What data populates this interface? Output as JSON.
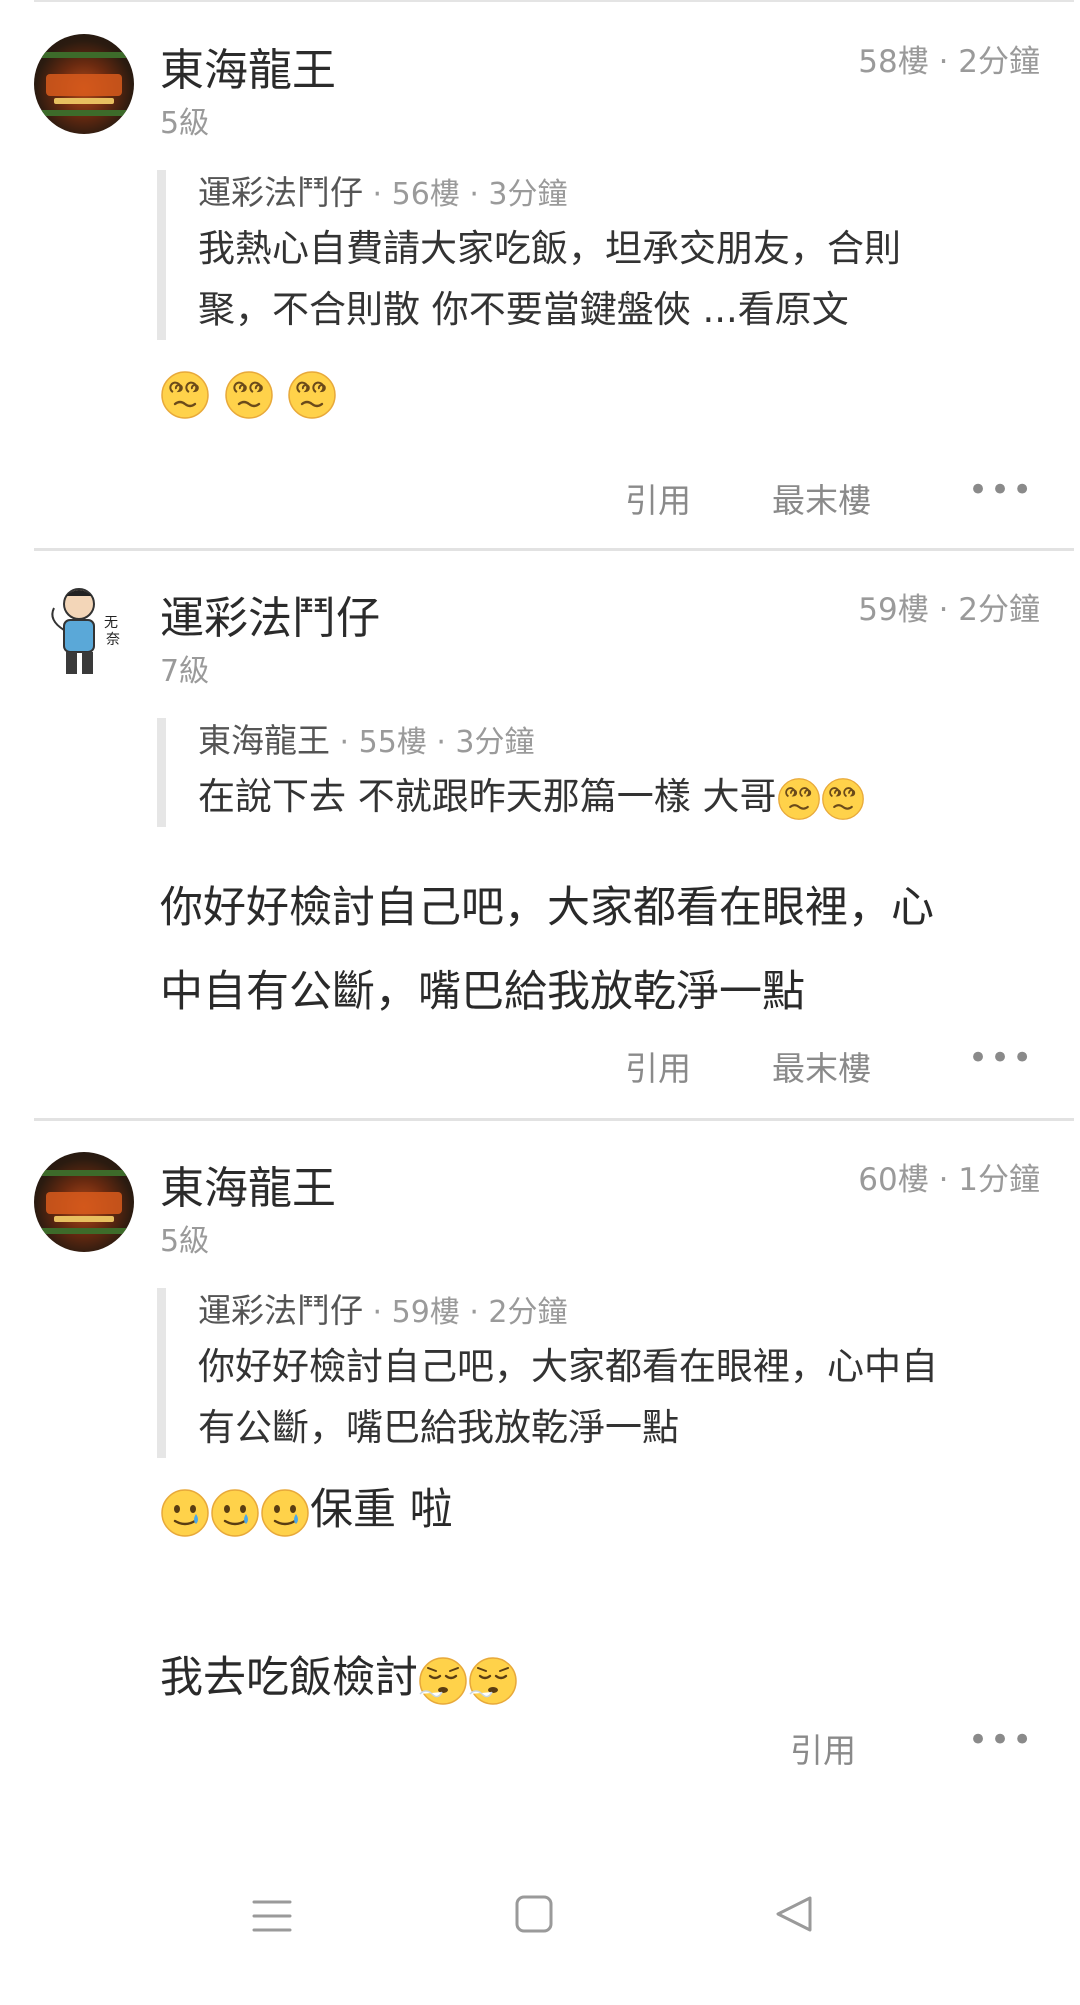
{
  "posts": [
    {
      "username": "東海龍王",
      "level": "5級",
      "meta": "58樓 · 2分鐘",
      "quote": {
        "author": "運彩法鬥仔",
        "meta": " · 56樓 · 3分鐘",
        "text_line1": "我熱心自費請大家吃飯，坦承交朋友，合則",
        "text_line2": "聚，不合則散 你不要當鍵盤俠 ...看原文"
      },
      "emoji_icon": "dizzy-face-emoji",
      "actions": {
        "quote": "引用",
        "last_floor": "最末樓"
      }
    },
    {
      "username": "運彩法鬥仔",
      "level": "7級",
      "meta": "59樓 · 2分鐘",
      "quote": {
        "author": "東海龍王",
        "meta": " · 55樓 · 3分鐘",
        "text": "在說下去 不就跟昨天那篇一樣 大哥"
      },
      "reply_line1": "你好好檢討自己吧，大家都看在眼裡，心",
      "reply_line2": "中自有公斷，嘴巴給我放乾淨一點",
      "actions": {
        "quote": "引用",
        "last_floor": "最末樓"
      }
    },
    {
      "username": "東海龍王",
      "level": "5級",
      "meta": "60樓 · 1分鐘",
      "quote": {
        "author": "運彩法鬥仔",
        "meta": " · 59樓 · 2分鐘",
        "text_line1": "你好好檢討自己吧，大家都看在眼裡，心中自",
        "text_line2": "有公斷，嘴巴給我放乾淨一點"
      },
      "reply_line1": "保重 啦",
      "reply_line2": "我去吃飯檢討",
      "actions": {
        "quote": "引用"
      }
    }
  ],
  "nav": {
    "icons": [
      "menu-icon",
      "home-icon",
      "back-icon"
    ]
  }
}
